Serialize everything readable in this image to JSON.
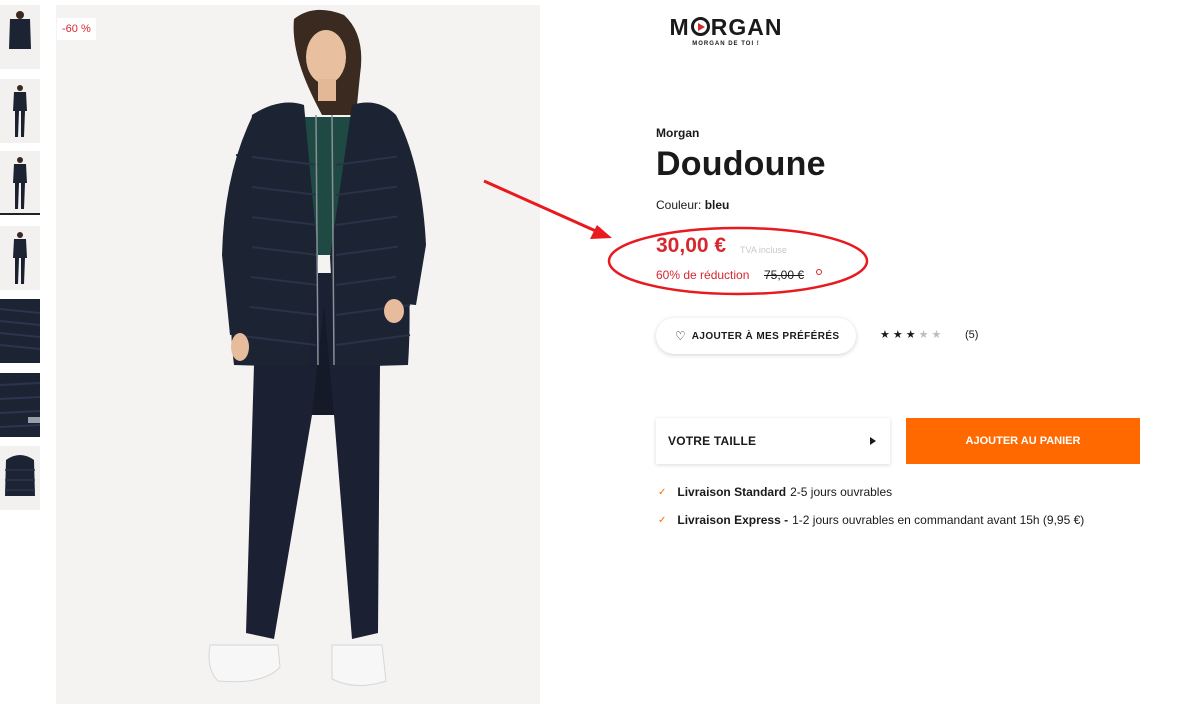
{
  "discount_badge": "-60 %",
  "logo": {
    "main_left": "M",
    "main_right": "RGAN",
    "tagline": "MORGAN DE TOI !"
  },
  "product": {
    "brand": "Morgan",
    "title": "Doudoune",
    "color_label": "Couleur:",
    "color_value": "bleu"
  },
  "price": {
    "current": "30,00 €",
    "vat_note": "TVA incluse",
    "discount_text": "60% de réduction",
    "old_price": "75,00 €"
  },
  "favorite_label": "AJOUTER À MES PRÉFÉRÉS",
  "rating": {
    "stars": 3,
    "max": 5,
    "count": "(5)"
  },
  "size_label": "VOTRE TAILLE",
  "cart_label": "AJOUTER AU PANIER",
  "delivery": [
    {
      "title": "Livraison Standard",
      "detail": "2-5 jours ouvrables"
    },
    {
      "title": "Livraison Express -",
      "detail": "1-2 jours ouvrables en commandant avant 15h (9,95 €)"
    }
  ],
  "colors": {
    "accent": "#ff6900",
    "price_red": "#d7282f",
    "jacket": "#1c2333"
  },
  "icons": [
    "heart-icon",
    "star-icon",
    "play-arrow-icon",
    "check-icon",
    "info-icon"
  ]
}
